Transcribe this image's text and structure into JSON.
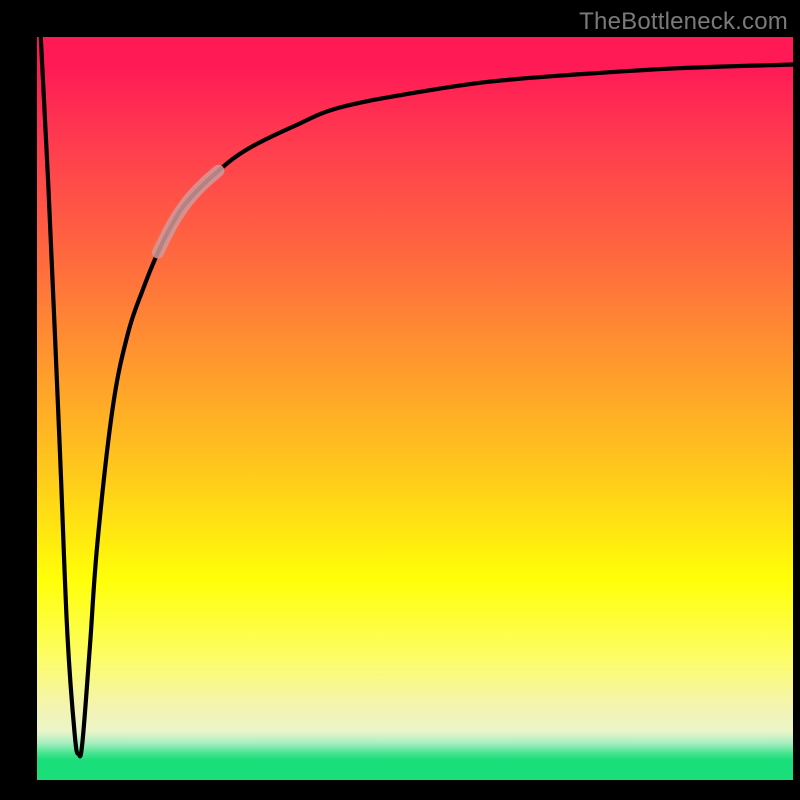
{
  "watermark": "TheBottleneck.com",
  "colors": {
    "frame": "#000000",
    "curve": "#000000",
    "highlight": "#d19a9a",
    "gradient_top": "#ff1a56",
    "gradient_bottom": "#1ade7a"
  },
  "chart_data": {
    "type": "line",
    "title": "",
    "xlabel": "",
    "ylabel": "",
    "xlim": [
      0,
      100
    ],
    "ylim": [
      0,
      100
    ],
    "note": "No axis ticks or labels are rendered; values are inferred from curve geometry on a 0–100 grid matching the plot area.",
    "series": [
      {
        "name": "bottleneck-curve",
        "x": [
          0.5,
          1.5,
          3.0,
          4.0,
          5.0,
          5.5,
          6.0,
          7.0,
          8.0,
          10.0,
          12.0,
          14.0,
          16.0,
          18.0,
          20.0,
          24.0,
          28.0,
          34.0,
          40.0,
          50.0,
          60.0,
          72.0,
          85.0,
          100.0
        ],
        "y": [
          100,
          80,
          45,
          20,
          6,
          3.5,
          5,
          18,
          32,
          50,
          60,
          66,
          71,
          75,
          78,
          82,
          85,
          88,
          90.5,
          92.5,
          94,
          95,
          95.8,
          96.3
        ]
      },
      {
        "name": "highlight-segment",
        "x": [
          16.0,
          18.0,
          20.0,
          22.0,
          24.0
        ],
        "y": [
          71.0,
          75.0,
          78.0,
          80.2,
          82.0
        ]
      }
    ]
  }
}
